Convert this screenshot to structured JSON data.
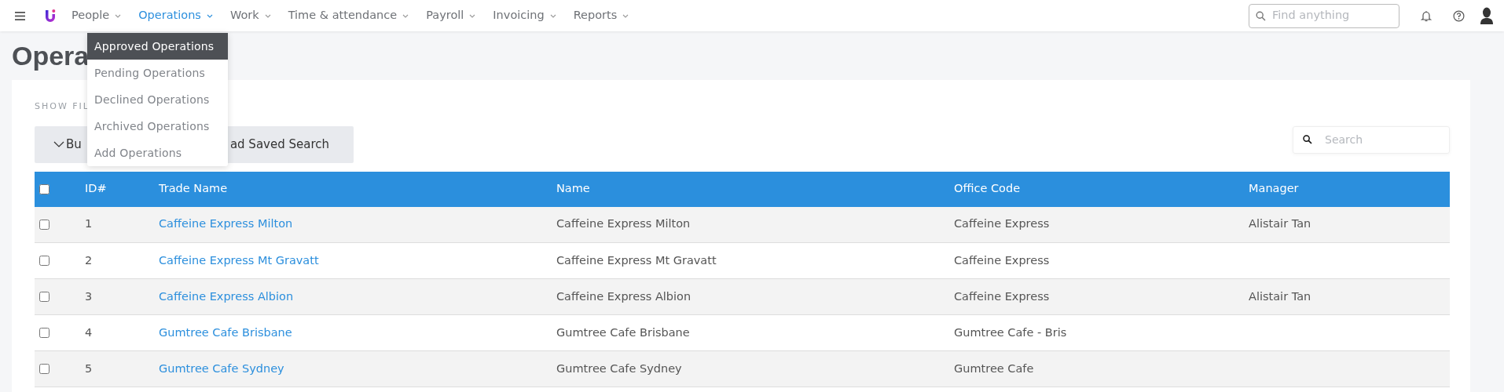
{
  "nav": {
    "items": [
      {
        "label": "People",
        "selected": false
      },
      {
        "label": "Operations",
        "selected": true
      },
      {
        "label": "Work",
        "selected": false
      },
      {
        "label": "Time & attendance",
        "selected": false
      },
      {
        "label": "Payroll",
        "selected": false
      },
      {
        "label": "Invoicing",
        "selected": false
      },
      {
        "label": "Reports",
        "selected": false
      }
    ],
    "search": {
      "placeholder": "Find anything"
    }
  },
  "dropdown": {
    "items": [
      {
        "label": "Approved Operations",
        "selected": true
      },
      {
        "label": "Pending Operations",
        "selected": false
      },
      {
        "label": "Declined Operations",
        "selected": false
      },
      {
        "label": "Archived Operations",
        "selected": false
      },
      {
        "label": "Add Operations",
        "selected": false
      }
    ]
  },
  "page": {
    "title": "Opera",
    "filters_label": "SHOW FIL",
    "buttons": [
      "Bu",
      "ad Saved Search"
    ],
    "search": {
      "placeholder": "Search"
    }
  },
  "table": {
    "select_all": {
      "checked": false
    },
    "columns": [
      "ID#",
      "Trade Name",
      "Name",
      "Office Code",
      "Manager"
    ],
    "rows": [
      {
        "checked": false,
        "cells": [
          "1",
          "Caffeine Express Milton",
          "Caffeine Express Milton",
          "Caffeine Express",
          "Alistair Tan"
        ]
      },
      {
        "checked": false,
        "cells": [
          "2",
          "Caffeine Express Mt Gravatt",
          "Caffeine Express Mt Gravatt",
          "Caffeine Express",
          ""
        ]
      },
      {
        "checked": false,
        "cells": [
          "3",
          "Caffeine Express Albion",
          "Caffeine Express Albion",
          "Caffeine Express",
          "Alistair Tan"
        ]
      },
      {
        "checked": false,
        "cells": [
          "4",
          "Gumtree Cafe Brisbane",
          "Gumtree Cafe Brisbane",
          "Gumtree Cafe - Bris",
          ""
        ]
      },
      {
        "checked": false,
        "cells": [
          "5",
          "Gumtree Cafe Sydney",
          "Gumtree Cafe Sydney",
          "Gumtree Cafe",
          ""
        ]
      }
    ]
  }
}
